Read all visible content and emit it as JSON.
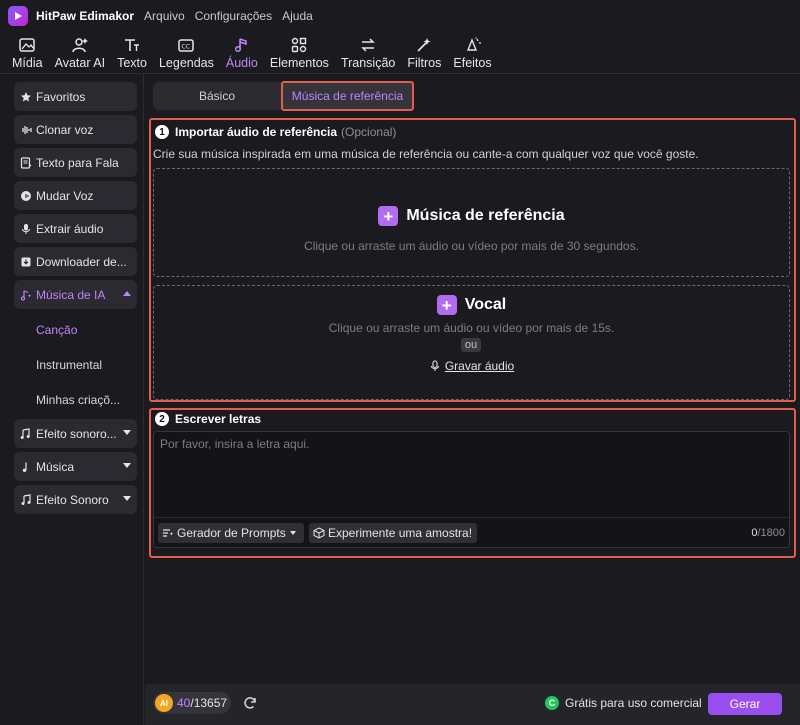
{
  "app": {
    "name": "HitPaw Edimakor",
    "menu": [
      "Arquivo",
      "Configurações",
      "Ajuda"
    ]
  },
  "toolbar": {
    "tools": [
      {
        "label": "Mídia",
        "icon": "media-icon"
      },
      {
        "label": "Avatar AI",
        "icon": "avatar-icon"
      },
      {
        "label": "Texto",
        "icon": "text-icon"
      },
      {
        "label": "Legendas",
        "icon": "captions-icon"
      },
      {
        "label": "Áudio",
        "icon": "audio-icon",
        "active": true
      },
      {
        "label": "Elementos",
        "icon": "elements-icon"
      },
      {
        "label": "Transição",
        "icon": "transition-icon"
      },
      {
        "label": "Filtros",
        "icon": "filters-icon"
      },
      {
        "label": "Efeitos",
        "icon": "effects-icon"
      }
    ]
  },
  "sidebar": {
    "items": [
      {
        "label": "Favoritos",
        "icon": "star-icon"
      },
      {
        "label": "Clonar voz",
        "icon": "voice-wave-icon"
      },
      {
        "label": "Texto para Fala",
        "icon": "text-to-speech-icon"
      },
      {
        "label": "Mudar Voz",
        "icon": "voice-changer-icon"
      },
      {
        "label": "Extrair áudio",
        "icon": "microphone-icon"
      },
      {
        "label": "Downloader de...",
        "icon": "download-icon"
      },
      {
        "label": "Música de IA",
        "icon": "ai-music-icon",
        "expanded": true,
        "active": true
      },
      {
        "label": "Efeito sonoro...",
        "icon": "sound-effect-icon"
      },
      {
        "label": "Música",
        "icon": "music-note-icon"
      },
      {
        "label": "Efeito Sonoro",
        "icon": "music-notes-icon"
      }
    ],
    "subitems": [
      {
        "label": "Canção",
        "active": true
      },
      {
        "label": "Instrumental"
      },
      {
        "label": "Minhas criaçõ..."
      }
    ]
  },
  "tabs": {
    "basic": "Básico",
    "reference": "Música de referência",
    "active": "reference"
  },
  "import_section": {
    "number": "1",
    "title": "Importar áudio de referência",
    "optional": "(Opcional)",
    "description": "Crie sua música inspirada em uma música de referência ou cante-a com qualquer voz que você goste.",
    "reference_drop": {
      "title": "Música de referência",
      "hint": "Clique ou arraste um áudio ou vídeo por mais de 30 segundos."
    },
    "vocal_drop": {
      "title": "Vocal",
      "hint": "Clique ou arraste um áudio ou vídeo por mais de 15s.",
      "or": "ou",
      "record": "Gravar áudio"
    }
  },
  "lyrics_section": {
    "number": "2",
    "title": "Escrever letras",
    "placeholder": "Por favor, insira a letra aqui.",
    "prompt_generator": "Gerador de Prompts",
    "try_sample": "Experimente uma amostra!",
    "count": "0",
    "max": "/1800"
  },
  "bottom": {
    "credits_used": "40",
    "credits_total": "/13657",
    "commercial": "Grátis para uso comercial",
    "generate": "Gerar"
  },
  "colors": {
    "accent": "#9b4ef0",
    "accent_text": "#c084fc",
    "highlight_border": "#e25d4c",
    "background": "#1b1b1f"
  }
}
